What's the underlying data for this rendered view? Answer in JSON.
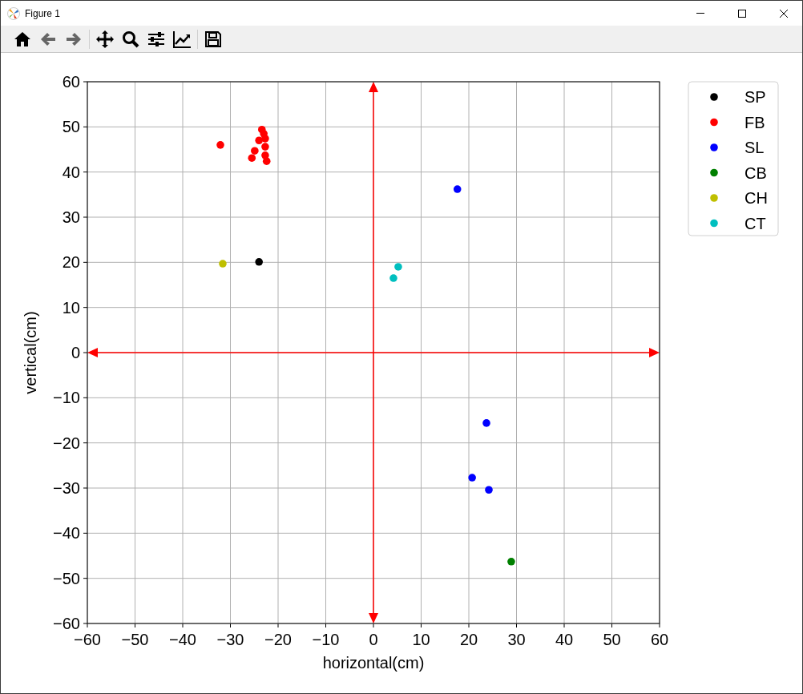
{
  "window": {
    "title": "Figure 1"
  },
  "toolbar": {
    "buttons": [
      {
        "kind": "home"
      },
      {
        "kind": "back"
      },
      {
        "kind": "forward"
      },
      {
        "kind": "pan"
      },
      {
        "kind": "zoom"
      },
      {
        "kind": "subplots"
      },
      {
        "kind": "axes"
      },
      {
        "kind": "save"
      }
    ]
  },
  "chart_data": {
    "type": "scatter",
    "xlabel": "horizontal(cm)",
    "ylabel": "vertical(cm)",
    "xlim": [
      -60,
      60
    ],
    "ylim": [
      -60,
      60
    ],
    "xticks": [
      -60,
      -50,
      -40,
      -30,
      -20,
      -10,
      0,
      10,
      20,
      30,
      40,
      50,
      60
    ],
    "yticks": [
      -60,
      -50,
      -40,
      -30,
      -20,
      -10,
      0,
      10,
      20,
      30,
      40,
      50,
      60
    ],
    "series": [
      {
        "name": "SP",
        "color": "#000000",
        "x": [
          -24.0
        ],
        "values": [
          20.1
        ]
      },
      {
        "name": "FB",
        "color": "#ff0000",
        "x": [
          -32.1,
          -23.4,
          -23.0,
          -22.7,
          -24.0,
          -24.9,
          -22.7,
          -25.5,
          -22.7,
          -22.4
        ],
        "values": [
          46.0,
          49.4,
          48.5,
          47.4,
          47.0,
          44.7,
          45.6,
          43.1,
          43.7,
          42.4
        ]
      },
      {
        "name": "SL",
        "color": "#0000ff",
        "x": [
          17.6,
          23.7,
          20.7,
          24.2
        ],
        "values": [
          36.2,
          -15.6,
          -27.7,
          -30.4
        ]
      },
      {
        "name": "CB",
        "color": "#008000",
        "x": [
          28.9
        ],
        "values": [
          -46.3
        ]
      },
      {
        "name": "CH",
        "color": "#bfbf00",
        "x": [
          -31.6
        ],
        "values": [
          19.7
        ]
      },
      {
        "name": "CT",
        "color": "#00bfbf",
        "x": [
          5.2,
          4.2
        ],
        "values": [
          19.0,
          16.5
        ]
      }
    ],
    "grid": true,
    "legend": true
  }
}
